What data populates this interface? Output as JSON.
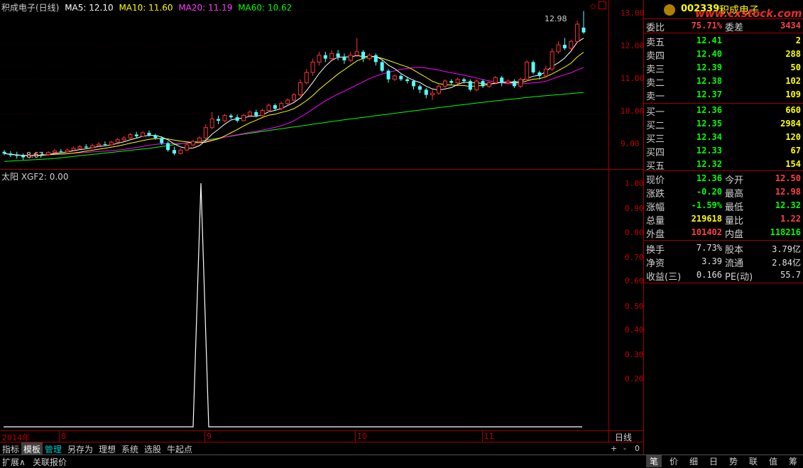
{
  "stock": {
    "title": "积成电子(日线)",
    "code": "002339",
    "name": "积成电子",
    "watermark": "www.cxstock.com"
  },
  "ma": [
    {
      "label": "MA5: 12.10",
      "color": "#ffffff"
    },
    {
      "label": "MA10: 11.60",
      "color": "#ffff00"
    },
    {
      "label": "MA20: 11.19",
      "color": "#ff00ff"
    },
    {
      "label": "MA60: 10.62",
      "color": "#00ff00"
    }
  ],
  "price_axis": [
    "13.00",
    "12.00",
    "11.00",
    "10.00",
    "9.00"
  ],
  "price_annotations": {
    "high": "12.98",
    "low": "8.67"
  },
  "indicator": {
    "label": "太阳 XGF2: 0.00",
    "axis": [
      "1.00",
      "0.90",
      "0.80",
      "0.70",
      "0.60",
      "0.50",
      "0.40",
      "0.30",
      "0.20"
    ]
  },
  "chart_data": {
    "type": "candlestick",
    "ylim": [
      8.4,
      13.3
    ],
    "candles": [
      [
        8.9,
        8.85,
        8.95,
        8.8
      ],
      [
        8.85,
        8.8,
        8.92,
        8.75
      ],
      [
        8.8,
        8.78,
        8.9,
        8.7
      ],
      [
        8.78,
        8.74,
        8.85,
        8.67
      ],
      [
        8.74,
        8.8,
        8.84,
        8.7
      ],
      [
        8.8,
        8.84,
        8.88,
        8.76
      ],
      [
        8.84,
        8.82,
        8.9,
        8.78
      ],
      [
        8.82,
        8.88,
        8.92,
        8.79
      ],
      [
        8.88,
        8.92,
        8.98,
        8.85
      ],
      [
        8.92,
        8.9,
        8.98,
        8.86
      ],
      [
        8.9,
        8.95,
        9.0,
        8.88
      ],
      [
        8.95,
        9.0,
        9.05,
        8.92
      ],
      [
        9.0,
        9.05,
        9.1,
        8.97
      ],
      [
        9.05,
        9.02,
        9.12,
        8.98
      ],
      [
        9.02,
        9.08,
        9.14,
        9.0
      ],
      [
        9.08,
        9.12,
        9.18,
        9.05
      ],
      [
        9.12,
        9.1,
        9.2,
        9.06
      ],
      [
        9.1,
        9.18,
        9.22,
        9.08
      ],
      [
        9.18,
        9.25,
        9.3,
        9.15
      ],
      [
        9.25,
        9.3,
        9.35,
        9.2
      ],
      [
        9.3,
        9.4,
        9.45,
        9.25
      ],
      [
        9.4,
        9.35,
        9.48,
        9.3
      ],
      [
        9.35,
        9.45,
        9.5,
        9.32
      ],
      [
        9.45,
        9.38,
        9.52,
        9.34
      ],
      [
        9.38,
        9.3,
        9.42,
        9.25
      ],
      [
        9.3,
        9.15,
        9.35,
        9.1
      ],
      [
        9.15,
        8.95,
        9.2,
        8.9
      ],
      [
        8.95,
        8.85,
        9.05,
        8.8
      ],
      [
        8.85,
        8.95,
        9.0,
        8.82
      ],
      [
        8.95,
        9.1,
        9.15,
        8.92
      ],
      [
        9.1,
        9.2,
        9.25,
        9.05
      ],
      [
        9.2,
        9.3,
        9.35,
        9.15
      ],
      [
        9.3,
        9.6,
        9.7,
        9.25
      ],
      [
        9.6,
        9.85,
        10.05,
        9.55
      ],
      [
        9.85,
        9.8,
        9.95,
        9.7
      ],
      [
        9.8,
        9.95,
        10.0,
        9.75
      ],
      [
        9.95,
        9.9,
        10.0,
        9.85
      ],
      [
        9.9,
        9.8,
        9.98,
        9.75
      ],
      [
        9.8,
        9.95,
        10.0,
        9.78
      ],
      [
        9.95,
        10.05,
        10.1,
        9.9
      ],
      [
        10.05,
        9.95,
        10.12,
        9.9
      ],
      [
        9.95,
        10.1,
        10.15,
        9.92
      ],
      [
        10.1,
        10.25,
        10.3,
        10.05
      ],
      [
        10.25,
        10.15,
        10.3,
        10.1
      ],
      [
        10.15,
        10.3,
        10.35,
        10.1
      ],
      [
        10.3,
        10.4,
        10.45,
        10.25
      ],
      [
        10.4,
        10.55,
        10.6,
        10.35
      ],
      [
        10.55,
        10.9,
        11.0,
        10.5
      ],
      [
        10.9,
        11.2,
        11.3,
        10.85
      ],
      [
        11.2,
        11.5,
        11.6,
        11.1
      ],
      [
        11.5,
        11.7,
        11.8,
        11.4
      ],
      [
        11.7,
        11.6,
        11.8,
        11.5
      ],
      [
        11.6,
        11.75,
        11.85,
        11.55
      ],
      [
        11.75,
        11.65,
        11.85,
        11.55
      ],
      [
        11.65,
        11.55,
        11.75,
        11.45
      ],
      [
        11.55,
        11.7,
        11.8,
        11.5
      ],
      [
        11.7,
        11.8,
        12.2,
        11.65
      ],
      [
        11.8,
        11.6,
        11.85,
        11.5
      ],
      [
        11.6,
        11.7,
        11.75,
        11.55
      ],
      [
        11.7,
        11.5,
        11.75,
        11.4
      ],
      [
        11.5,
        11.25,
        11.55,
        11.2
      ],
      [
        11.25,
        11.0,
        11.3,
        10.9
      ],
      [
        11.0,
        11.1,
        11.15,
        10.95
      ],
      [
        11.1,
        11.0,
        11.15,
        10.95
      ],
      [
        11.0,
        10.95,
        11.05,
        10.88
      ],
      [
        10.95,
        10.8,
        11.0,
        10.7
      ],
      [
        10.8,
        10.7,
        10.85,
        10.6
      ],
      [
        10.7,
        10.55,
        10.75,
        10.45
      ],
      [
        10.55,
        10.6,
        10.7,
        10.4
      ],
      [
        10.6,
        10.8,
        10.85,
        10.55
      ],
      [
        10.8,
        10.95,
        11.0,
        10.75
      ],
      [
        10.95,
        10.9,
        11.0,
        10.85
      ],
      [
        10.9,
        11.0,
        11.05,
        10.85
      ],
      [
        11.0,
        10.95,
        11.05,
        10.88
      ],
      [
        10.95,
        10.7,
        11.0,
        10.65
      ],
      [
        10.7,
        10.95,
        11.0,
        10.65
      ],
      [
        10.95,
        10.8,
        11.0,
        10.75
      ],
      [
        10.8,
        10.9,
        10.95,
        10.75
      ],
      [
        10.9,
        11.05,
        11.1,
        10.85
      ],
      [
        11.05,
        10.9,
        11.1,
        10.8
      ],
      [
        10.9,
        10.95,
        11.0,
        10.85
      ],
      [
        10.95,
        10.8,
        11.0,
        10.75
      ],
      [
        10.8,
        11.0,
        11.05,
        10.75
      ],
      [
        11.0,
        11.5,
        11.55,
        10.95
      ],
      [
        11.5,
        11.2,
        11.55,
        11.15
      ],
      [
        11.2,
        11.1,
        11.25,
        11.0
      ],
      [
        11.1,
        11.3,
        11.4,
        11.05
      ],
      [
        11.3,
        11.8,
        11.9,
        11.25
      ],
      [
        11.8,
        12.0,
        12.1,
        11.75
      ],
      [
        12.0,
        11.9,
        12.2,
        11.85
      ],
      [
        11.9,
        12.1,
        12.15,
        11.85
      ],
      [
        12.1,
        12.6,
        12.7,
        12.05
      ],
      [
        12.5,
        12.36,
        12.98,
        12.32
      ]
    ],
    "ma60": [
      8.62,
      8.7,
      8.85,
      9.0,
      9.2,
      9.42,
      9.62,
      9.82,
      10.0,
      10.18,
      10.35,
      10.5,
      10.62
    ]
  },
  "quote": {
    "rows": [
      {
        "label": "委比",
        "v1": "75.71%",
        "v1c": "#ff4040",
        "label2": "委差",
        "v2": "3434",
        "v2c": "#ff4040"
      }
    ],
    "asks": [
      {
        "label": "卖五",
        "price": "12.41",
        "vol": "2"
      },
      {
        "label": "卖四",
        "price": "12.40",
        "vol": "288"
      },
      {
        "label": "卖三",
        "price": "12.39",
        "vol": "50"
      },
      {
        "label": "卖二",
        "price": "12.38",
        "vol": "102"
      },
      {
        "label": "卖一",
        "price": "12.37",
        "vol": "109"
      }
    ],
    "bids": [
      {
        "label": "买一",
        "price": "12.36",
        "vol": "660"
      },
      {
        "label": "买二",
        "price": "12.35",
        "vol": "2984"
      },
      {
        "label": "买三",
        "price": "12.34",
        "vol": "120"
      },
      {
        "label": "买四",
        "price": "12.33",
        "vol": "67"
      },
      {
        "label": "买五",
        "price": "12.32",
        "vol": "154"
      }
    ],
    "stats": [
      {
        "l1": "现价",
        "v1": "12.36",
        "c1": "#00ff00",
        "l2": "今开",
        "v2": "12.50",
        "c2": "#ff4040"
      },
      {
        "l1": "涨跌",
        "v1": "-0.20",
        "c1": "#00ff00",
        "l2": "最高",
        "v2": "12.98",
        "c2": "#ff4040"
      },
      {
        "l1": "涨幅",
        "v1": "-1.59%",
        "c1": "#00ff00",
        "l2": "最低",
        "v2": "12.32",
        "c2": "#00ff00"
      },
      {
        "l1": "总量",
        "v1": "219618",
        "c1": "#ffff00",
        "l2": "量比",
        "v2": "1.22",
        "c2": "#ff4040"
      },
      {
        "l1": "外盘",
        "v1": "101402",
        "c1": "#ff4040",
        "l2": "内盘",
        "v2": "118216",
        "c2": "#00ff00"
      }
    ],
    "fund": [
      {
        "l1": "换手",
        "v1": "7.73%",
        "l2": "股本",
        "v2": "3.79亿"
      },
      {
        "l1": "净资",
        "v1": "3.39",
        "l2": "流通",
        "v2": "2.84亿"
      },
      {
        "l1": "收益(三)",
        "v1": "0.166",
        "l2": "PE(动)",
        "v2": "55.7"
      }
    ]
  },
  "time_axis": {
    "year": "2014年",
    "m8": "8",
    "m9": "9",
    "m10": "10",
    "m11": "11",
    "period": "日线"
  },
  "tabs": [
    "指标",
    "模板",
    "管理",
    "另存为",
    "理想",
    "系统",
    "选股",
    "牛起点"
  ],
  "bottom": {
    "expand": "扩展∧",
    "related": "关联报价",
    "right_tabs": [
      "笔",
      "价",
      "细",
      "日",
      "势",
      "联",
      "值",
      "筹"
    ],
    "zoom": [
      "+",
      "-",
      "0"
    ]
  }
}
